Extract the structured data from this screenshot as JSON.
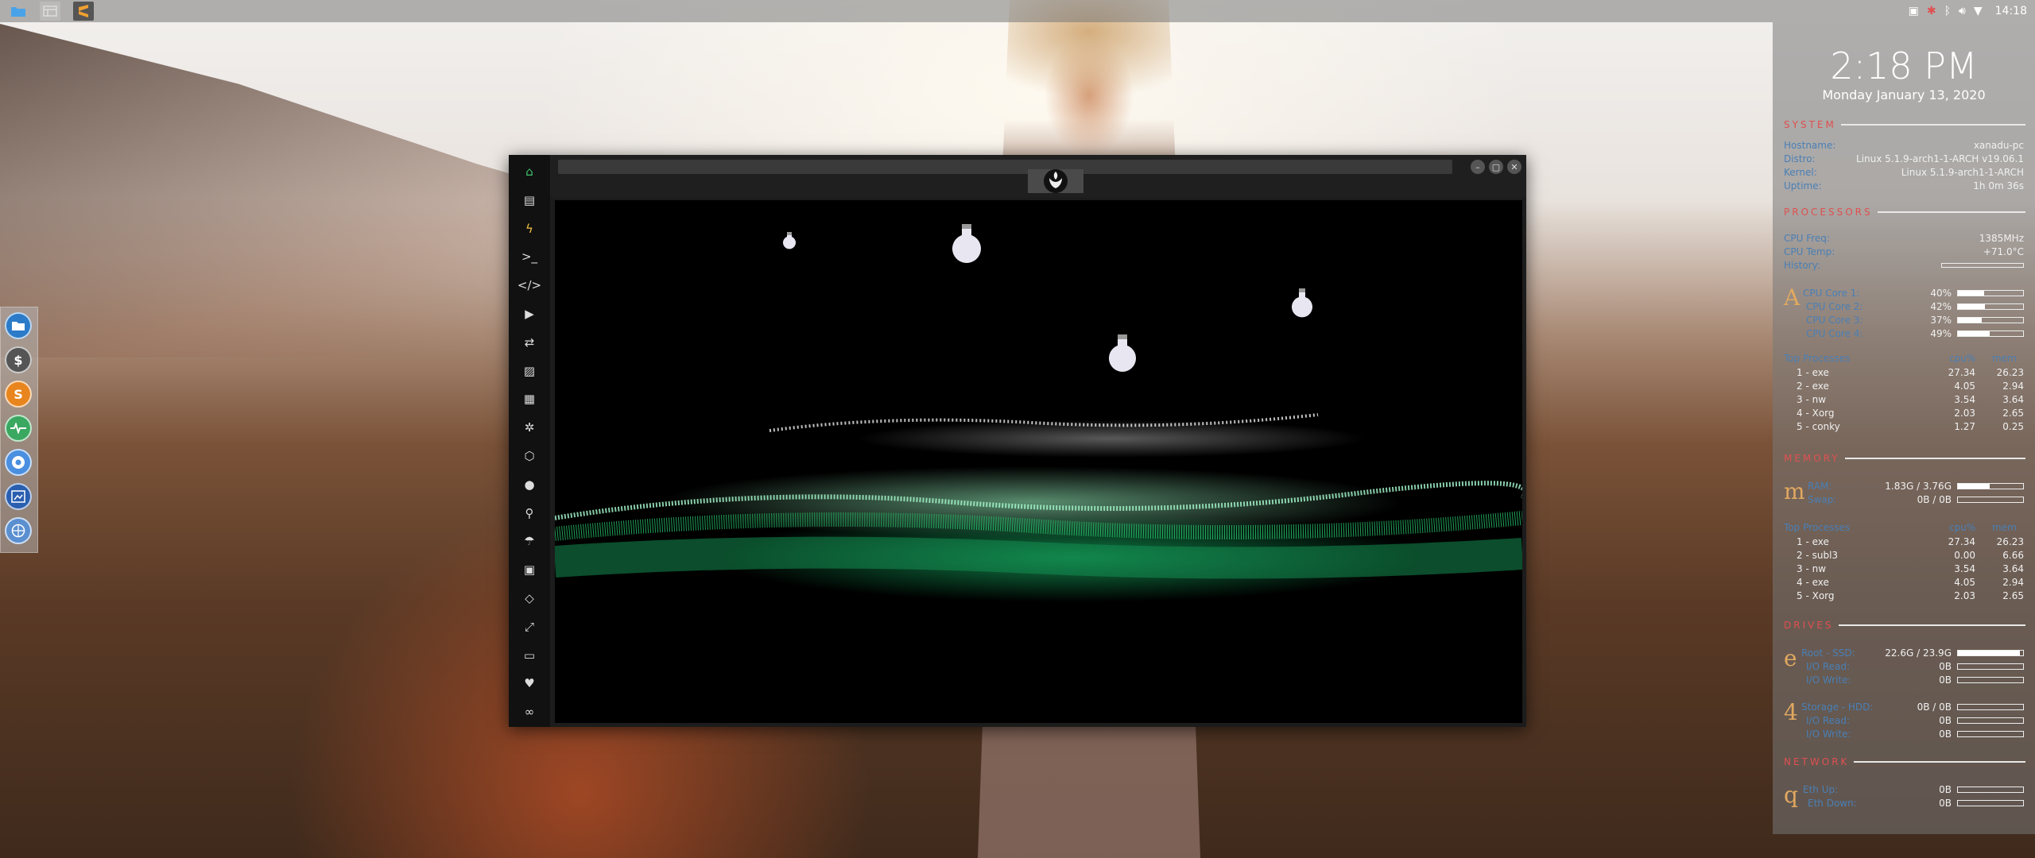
{
  "taskbar": {
    "launchers": [
      "file-manager-icon",
      "apps-grid-icon",
      "sublime-text-icon"
    ],
    "tray_icons": [
      "screenshot-icon",
      "pointer-icon",
      "bluetooth-icon",
      "volume-icon",
      "wifi-icon"
    ],
    "clock": "14:18"
  },
  "dock": {
    "items": [
      "file-manager-icon",
      "terminal-icon",
      "sublime-text-icon",
      "system-monitor-icon",
      "chrome-icon",
      "screenshot-tool-icon",
      "network-icon"
    ],
    "labels": {
      "terminal": "$",
      "sublime": "S"
    }
  },
  "window": {
    "sidebar_icons": [
      "home-icon",
      "document-icon",
      "lightning-icon",
      "terminal-prompt-icon",
      "code-icon",
      "play-icon",
      "translate-icon",
      "image-icon",
      "news-icon",
      "settings-icon",
      "hexagon-icon",
      "globe-icon",
      "search-icon",
      "umbrella-icon",
      "contact-icon",
      "swap-icon",
      "fullscreen-icon",
      "youtube-icon",
      "heart-icon",
      "infinity-icon"
    ],
    "sidebar_glyphs": [
      "⌂",
      "▤",
      "ϟ",
      ">_",
      "</>",
      "▶",
      "⇄",
      "▨",
      "▦",
      "✲",
      "⬡",
      "●",
      "⚲",
      "☂",
      "▣",
      "◇",
      "⤢",
      "▭",
      "♥",
      "∞"
    ],
    "controls": {
      "minimize": "–",
      "maximize": "▢",
      "close": "✕"
    }
  },
  "conky": {
    "time": "2:18 PM",
    "date": "Monday January 13, 2020",
    "system": {
      "title": "SYSTEM",
      "rows": [
        {
          "label": "Hostname:",
          "value": "xanadu-pc"
        },
        {
          "label": "Distro:",
          "value": "Linux 5.1.9-arch1-1-ARCH v19.06.1"
        },
        {
          "label": "Kernel:",
          "value": "Linux 5.1.9-arch1-1-ARCH"
        },
        {
          "label": "Uptime:",
          "value": "1h 0m 36s"
        }
      ]
    },
    "processors": {
      "title": "PROCESSORS",
      "freq_label": "CPU Freq:",
      "freq": "1385MHz",
      "temp_label": "CPU Temp:",
      "temp": "+71.0°C",
      "history_label": "History:",
      "glyph": "A",
      "cores": [
        {
          "label": "CPU Core 1:",
          "value": "40%",
          "fill": 0.4
        },
        {
          "label": "CPU Core 2:",
          "value": "42%",
          "fill": 0.42
        },
        {
          "label": "CPU Core 3:",
          "value": "37%",
          "fill": 0.37
        },
        {
          "label": "CPU Core 4:",
          "value": "49%",
          "fill": 0.49
        }
      ],
      "top_label": "Top Processes",
      "cpu_h": "cpu%",
      "mem_h": "mem",
      "top": [
        {
          "name": "1  -  exe",
          "cpu": "27.34",
          "mem": "26.23"
        },
        {
          "name": "2  -  exe",
          "cpu": "4.05",
          "mem": "2.94"
        },
        {
          "name": "3  -  nw",
          "cpu": "3.54",
          "mem": "3.64"
        },
        {
          "name": "4  -  Xorg",
          "cpu": "2.03",
          "mem": "2.65"
        },
        {
          "name": "5  -  conky",
          "cpu": "1.27",
          "mem": "0.25"
        }
      ]
    },
    "memory": {
      "title": "MEMORY",
      "glyph": "m",
      "ram_label": "RAM:",
      "ram": "1.83G / 3.76G",
      "ram_fill": 0.49,
      "swap_label": "Swap:",
      "swap": "0B / 0B",
      "swap_fill": 0.0,
      "top_label": "Top Processes",
      "cpu_h": "cpu%",
      "mem_h": "mem",
      "top": [
        {
          "name": "1  -  exe",
          "cpu": "27.34",
          "mem": "26.23"
        },
        {
          "name": "2  -  subl3",
          "cpu": "0.00",
          "mem": "6.66"
        },
        {
          "name": "3  -  nw",
          "cpu": "3.54",
          "mem": "3.64"
        },
        {
          "name": "4  -  exe",
          "cpu": "4.05",
          "mem": "2.94"
        },
        {
          "name": "5  -  Xorg",
          "cpu": "2.03",
          "mem": "2.65"
        }
      ]
    },
    "drives": {
      "title": "DRIVES",
      "root_glyph": "e",
      "root_label": "Root  -  SSD:",
      "root": "22.6G / 23.9G",
      "root_fill": 0.95,
      "root_read_label": "I/O Read:",
      "root_read": "0B",
      "root_write_label": "I/O Write:",
      "root_write": "0B",
      "storage_glyph": "4",
      "storage_label": "Storage  -  HDD:",
      "storage": "0B / 0B",
      "storage_fill": 0.0,
      "storage_read_label": "I/O Read:",
      "storage_read": "0B",
      "storage_write_label": "I/O Write:",
      "storage_write": "0B"
    },
    "network": {
      "title": "NETWORK",
      "glyph": "q",
      "up_label": "Eth Up:",
      "up": "0B",
      "down_label": "Eth Down:",
      "down": "0B"
    }
  }
}
